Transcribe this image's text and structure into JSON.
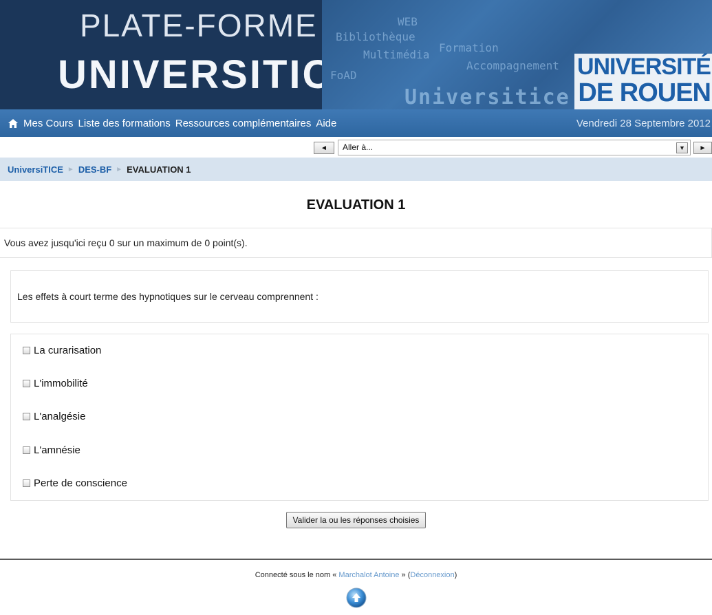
{
  "banner": {
    "title_line1": "PLATE-FORME",
    "title_line2": "UNIVERSITICE",
    "mosaic_words": [
      "WEB",
      "Accompagnement",
      "FoAD",
      "Bibliothèque",
      "Formation",
      "Multimédia"
    ],
    "mosaic_big": "Universitice",
    "university_logo_line1": "UNIVERSITÉ",
    "university_logo_line2": "DE ROUEN"
  },
  "nav": {
    "home_icon": "home-icon",
    "links": [
      "Mes Cours",
      "Liste des formations",
      "Ressources complémentaires",
      "Aide"
    ],
    "date": "Vendredi 28 Septembre 2012"
  },
  "jump": {
    "prev_label": "◄",
    "select_value": "Aller à...",
    "next_label": "►"
  },
  "breadcrumb": {
    "items": [
      "UniversiTICE",
      "DES-BF"
    ],
    "current": "EVALUATION 1",
    "separator": "►"
  },
  "main": {
    "title": "EVALUATION 1",
    "grade_text": "Vous avez jusqu'ici reçu 0 sur un maximum de 0 point(s).",
    "question": "Les effets à court terme des hypnotiques sur le cerveau comprennent :",
    "answers": [
      "La curarisation",
      "L'immobilité",
      "L'analgésie",
      "L'amnésie",
      "Perte de conscience"
    ],
    "submit_label": "Valider la ou les réponses choisies"
  },
  "footer": {
    "login_prefix": "Connecté sous le nom «",
    "user_name": "Marchalot Antoine",
    "login_mid": "» (",
    "logout_label": "Déconnexion",
    "login_suffix": ")",
    "home_icon": "home-bubble-icon"
  },
  "colors": {
    "banner_dark": "#1b3659",
    "nav_blue": "#3f79b5",
    "breadcrumb_bg": "#d7e3ef",
    "link_blue": "#1d5fa8"
  }
}
